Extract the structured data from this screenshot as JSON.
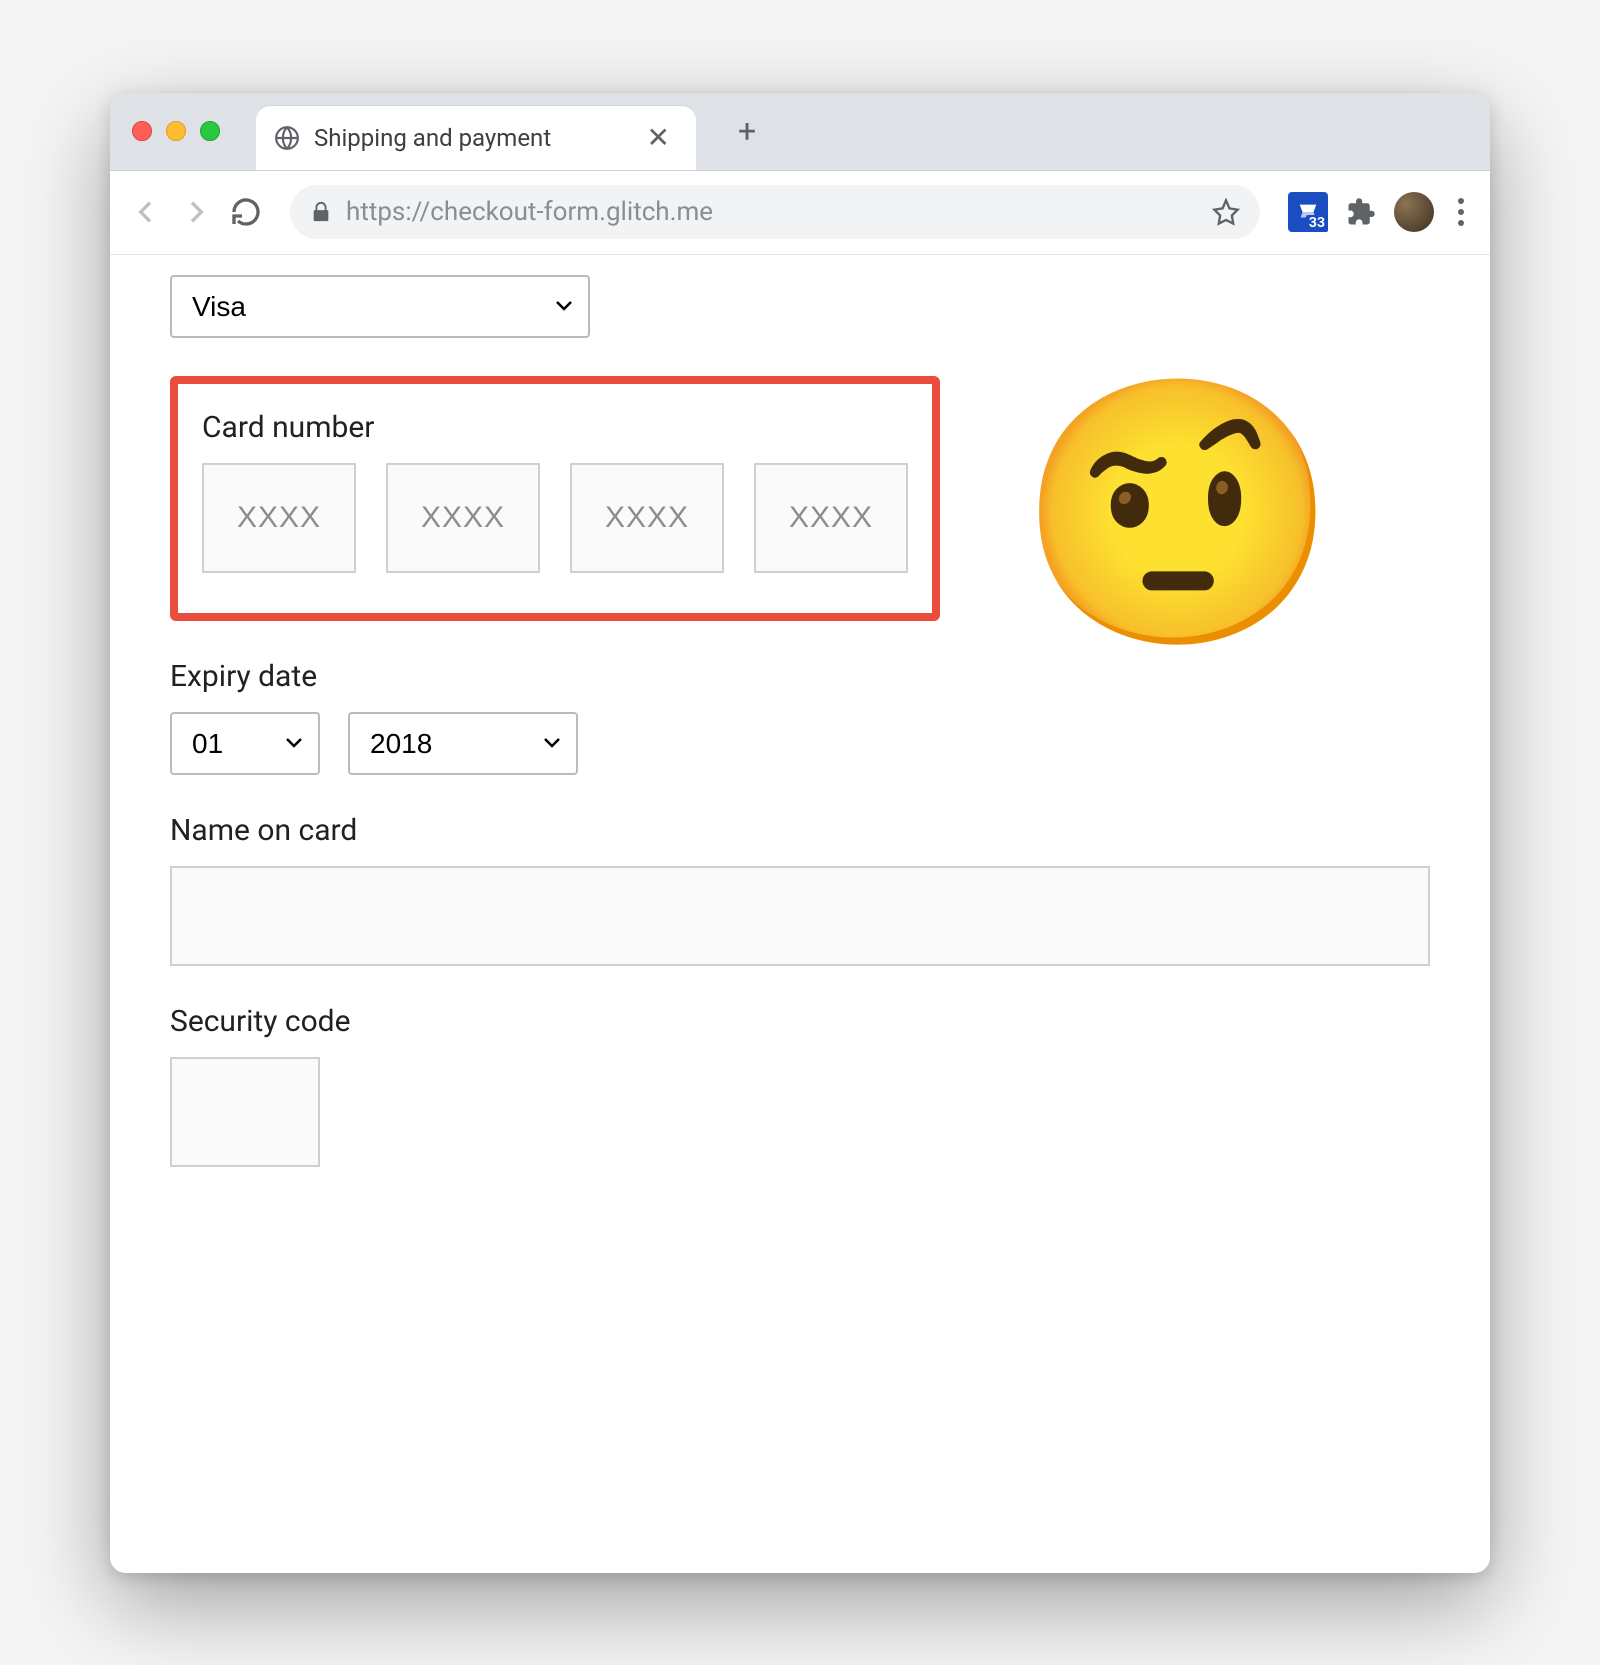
{
  "browser": {
    "tab_title": "Shipping and payment",
    "url": "https://checkout-form.glitch.me",
    "extension_badge": "33"
  },
  "form": {
    "card_type": {
      "value": "Visa"
    },
    "card_number": {
      "label": "Card number",
      "placeholder": "XXXX"
    },
    "expiry": {
      "label": "Expiry date",
      "month": "01",
      "year": "2018"
    },
    "name_on_card": {
      "label": "Name on card",
      "value": ""
    },
    "security_code": {
      "label": "Security code",
      "value": ""
    }
  },
  "annotation": {
    "emoji": "🤨"
  }
}
